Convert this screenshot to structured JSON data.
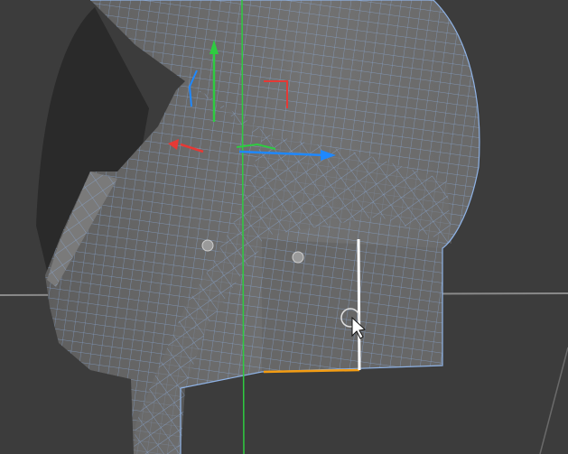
{
  "viewport": {
    "background_color": "#3c3c3c",
    "horizon_color": "#8a8a8a",
    "vertical_axis_color": "#2ecc40"
  },
  "model": {
    "surface_color": "#6b6b6b",
    "shadow_color": "#2a2a2a",
    "wireframe_color": "#8fb3e6",
    "selected_edge_color": "#ffffff",
    "boundary_edge_color": "#f39c12"
  },
  "gizmo": {
    "x_axis_color": "#e53935",
    "y_axis_color": "#2ecc40",
    "z_axis_color": "#1e88ff",
    "icons": [
      "move-gizmo-icon"
    ]
  },
  "cursor": {
    "icon": "arrow-pointer-icon",
    "brush_ring_icon": "circle-brush-icon"
  }
}
